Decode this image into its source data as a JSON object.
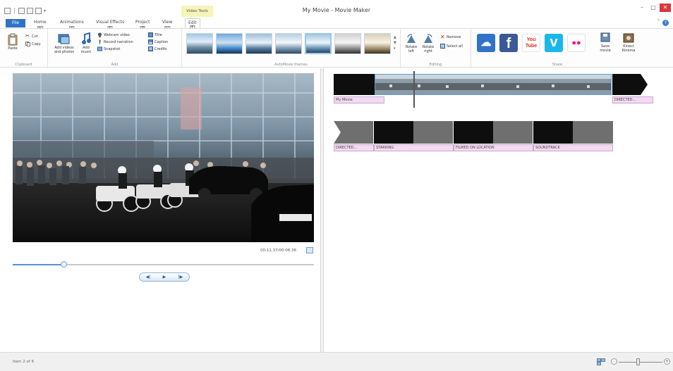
{
  "window": {
    "title": "My Movie - Movie Maker",
    "context_tab_label": "Video Tools",
    "controls": {
      "minimize": "–",
      "maximize": "▢",
      "close": "✕"
    }
  },
  "qat": {
    "caret": "▾"
  },
  "tabs": {
    "file": "File",
    "items": [
      {
        "label": "Home",
        "keytip": "H"
      },
      {
        "label": "Animations",
        "keytip": "A"
      },
      {
        "label": "Visual Effects",
        "keytip": "S"
      },
      {
        "label": "Project",
        "keytip": "P"
      },
      {
        "label": "View",
        "keytip": "V"
      },
      {
        "label": "Edit",
        "keytip": "T"
      }
    ],
    "help": "?",
    "minimize_ribbon": "^"
  },
  "ribbon": {
    "clipboard": {
      "label": "Clipboard",
      "paste": "Paste",
      "cut": "Cut",
      "copy": "Copy"
    },
    "add": {
      "label": "Add",
      "add_videos": "Add videos and photos",
      "add_music": "Add music",
      "webcam": "Webcam video",
      "record_narration": "Record narration",
      "snapshot": "Snapshot",
      "title": "Title",
      "caption": "Caption",
      "credits": "Credits"
    },
    "autothemes": {
      "label": "AutoMovie themes",
      "scroll_up": "▲",
      "scroll_down": "▼",
      "more": "▾"
    },
    "editing": {
      "label": "Editing",
      "rotate_left": "Rotate left",
      "rotate_right": "Rotate right",
      "remove": "Remove",
      "select_all": "Select all"
    },
    "share": {
      "label": "Share",
      "onedrive": "☁",
      "facebook": "f",
      "youtube": "You Tube",
      "vimeo": "v",
      "flickr": "●●",
      "save_movie": "Save movie",
      "kinect": "Kinect Kinema"
    }
  },
  "preview": {
    "timecode": "00:11.37/00:08.36",
    "seek_position": 0.17,
    "prev_frame": "◀|",
    "play": "▶",
    "next_frame": "|▶"
  },
  "storyboard": {
    "row1": {
      "caption": "My Movie",
      "end_caption": "DIRECTED..."
    },
    "row2": {
      "captions": [
        "DIRECTED...",
        "STARRING",
        "FILMED ON LOCATION",
        "SOUNDTRACK"
      ]
    }
  },
  "status": {
    "text": "Item 2 of 6",
    "zoom_out": "-",
    "zoom_in": "+",
    "zoom_level": 0.45
  }
}
